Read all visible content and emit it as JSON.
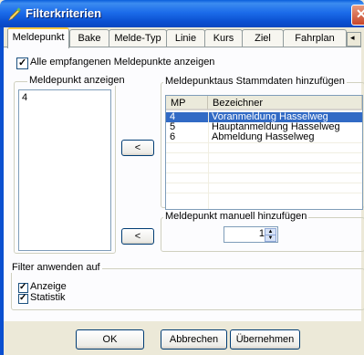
{
  "window": {
    "title": "Filterkriterien",
    "close_glyph": "✕"
  },
  "tabs": [
    {
      "label": "Meldepunkt",
      "active": true
    },
    {
      "label": "Bake"
    },
    {
      "label": "Melde-Typ"
    },
    {
      "label": "Linie"
    },
    {
      "label": "Kurs"
    },
    {
      "label": "Ziel"
    },
    {
      "label": "Fahrplan"
    }
  ],
  "tab_scroll_glyph": "◂",
  "all_checkbox": {
    "label": "Alle empfangenen Meldepunkte anzeigen",
    "checked": true
  },
  "show_group": {
    "title": "Meldepunkt anzeigen",
    "items": [
      "4"
    ]
  },
  "add_button_label": "<",
  "master_group": {
    "title": "Meldepunktaus Stammdaten hinzufügen",
    "columns": [
      "MP",
      "Bezeichner"
    ],
    "rows": [
      {
        "mp": "4",
        "name": "Voranmeldung Hasselweg",
        "selected": true
      },
      {
        "mp": "5",
        "name": "Hauptanmeldung Hasselweg"
      },
      {
        "mp": "6",
        "name": "Abmeldung Hasselweg"
      }
    ]
  },
  "manual_group": {
    "title": "Meldepunkt manuell hinzufügen",
    "value": "1"
  },
  "filter_group": {
    "title": "Filter anwenden auf",
    "options": [
      {
        "label": "Anzeige",
        "checked": true
      },
      {
        "label": "Statistik",
        "checked": true
      }
    ]
  },
  "buttons": {
    "ok": "OK",
    "cancel": "Abbrechen",
    "apply": "Übernehmen"
  },
  "colors": {
    "titlebar": "#0A4FD0",
    "selection": "#316AC5",
    "tab_highlight": "#FFC83C",
    "panel": "#FCFCFE",
    "face": "#ECE9D8"
  },
  "icons": {
    "title": "pencil-icon",
    "close": "close-icon",
    "check": "check-icon"
  }
}
